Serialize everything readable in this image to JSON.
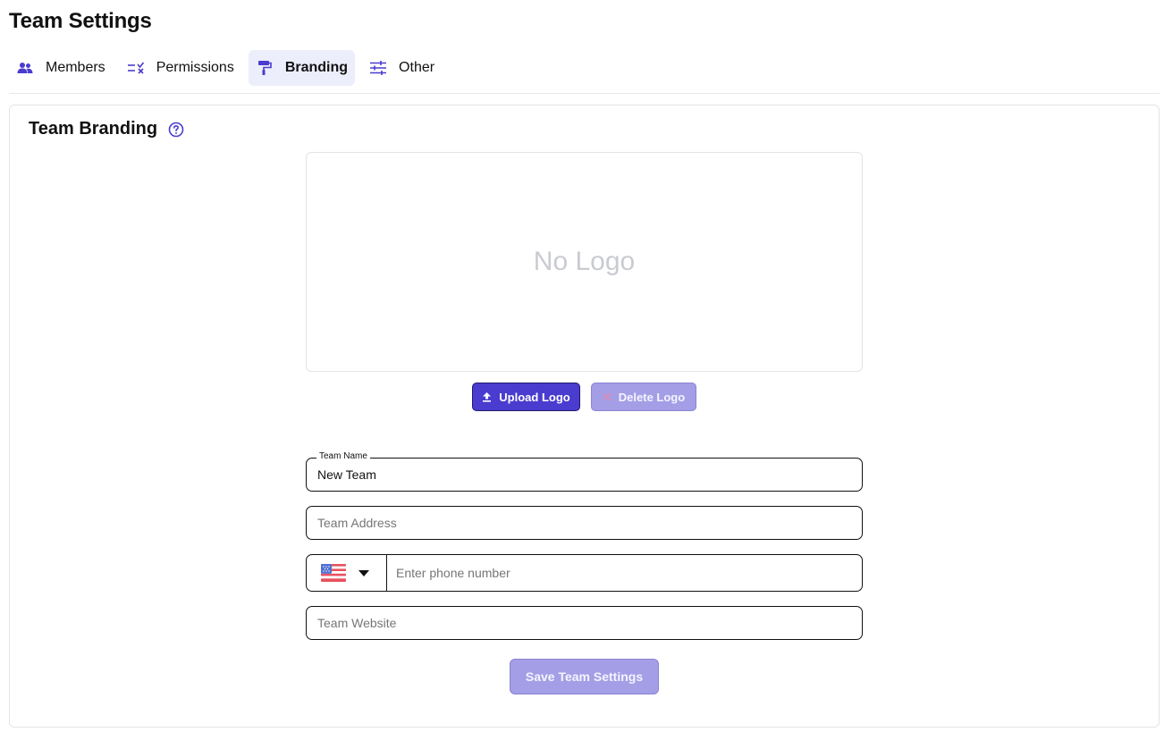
{
  "page": {
    "title": "Team Settings"
  },
  "tabs": [
    {
      "label": "Members",
      "icon": "people-icon"
    },
    {
      "label": "Permissions",
      "icon": "permissions-icon"
    },
    {
      "label": "Branding",
      "icon": "paint-roller-icon",
      "active": true
    },
    {
      "label": "Other",
      "icon": "sliders-icon"
    }
  ],
  "branding": {
    "title": "Team Branding",
    "help_icon": "question-circle-icon",
    "logo_placeholder": "No Logo",
    "upload_label": "Upload Logo",
    "delete_label": "Delete Logo"
  },
  "form": {
    "team_name": {
      "label": "Team Name",
      "value": "New Team"
    },
    "team_address": {
      "placeholder": "Team Address",
      "value": ""
    },
    "phone": {
      "country": "US",
      "flag_icon": "us-flag-icon",
      "placeholder": "Enter phone number",
      "value": ""
    },
    "team_website": {
      "placeholder": "Team Website",
      "value": ""
    },
    "save_label": "Save Team Settings"
  },
  "colors": {
    "accent": "#4a3ccf",
    "accent_disabled": "#a49ee6",
    "active_tab_bg": "#eceefb"
  }
}
